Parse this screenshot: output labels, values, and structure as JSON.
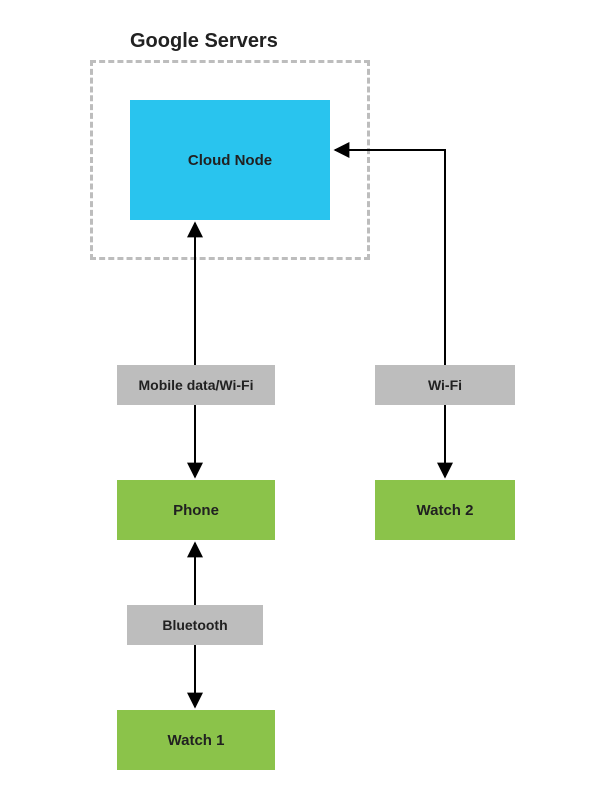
{
  "title": "Google Servers",
  "nodes": {
    "cloud": "Cloud Node",
    "phone": "Phone",
    "watch1": "Watch 1",
    "watch2": "Watch 2"
  },
  "edges": {
    "mobile": "Mobile data/Wi-Fi",
    "wifi": "Wi-Fi",
    "bluetooth": "Bluetooth"
  },
  "colors": {
    "cloud": "#29c4ee",
    "device": "#8bc34a",
    "label": "#bdbdbd",
    "dash": "#bdbdbd",
    "text": "#212121",
    "arrow": "#000000"
  },
  "chart_data": {
    "type": "diagram",
    "title": "Google Servers",
    "nodes": [
      {
        "id": "cloud",
        "label": "Cloud Node",
        "group": "Google Servers",
        "kind": "cloud"
      },
      {
        "id": "phone",
        "label": "Phone",
        "kind": "device"
      },
      {
        "id": "watch1",
        "label": "Watch 1",
        "kind": "device"
      },
      {
        "id": "watch2",
        "label": "Watch 2",
        "kind": "device"
      }
    ],
    "edges": [
      {
        "from": "phone",
        "to": "cloud",
        "label": "Mobile data/Wi-Fi",
        "bidirectional": true
      },
      {
        "from": "watch2",
        "to": "cloud",
        "label": "Wi-Fi",
        "bidirectional": true
      },
      {
        "from": "watch1",
        "to": "phone",
        "label": "Bluetooth",
        "bidirectional": true
      }
    ]
  }
}
